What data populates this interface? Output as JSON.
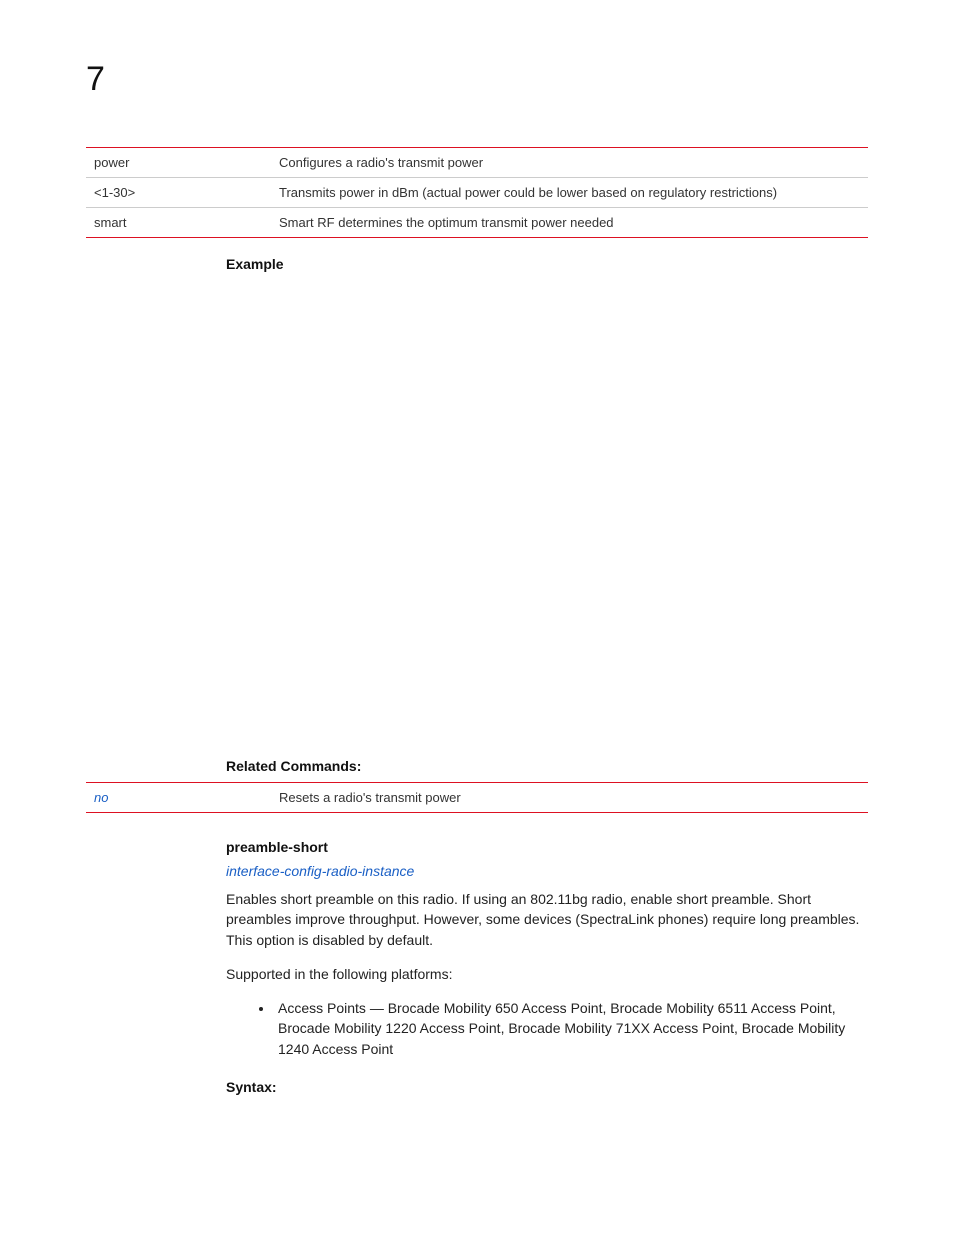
{
  "chapter_number": "7",
  "param_table": {
    "rows": [
      {
        "name": "power",
        "desc": "Configures a radio's transmit power"
      },
      {
        "name": "<1-30>",
        "desc": "Transmits power in dBm (actual power could be lower based on regulatory restrictions)"
      },
      {
        "name": "smart",
        "desc": "Smart RF determines the optimum transmit power needed"
      }
    ]
  },
  "headings": {
    "example": "Example",
    "related": "Related Commands:",
    "preamble": "preamble-short",
    "syntax": "Syntax:"
  },
  "related_table": {
    "rows": [
      {
        "cmd": "no",
        "desc": "Resets a radio's transmit power"
      }
    ]
  },
  "preamble": {
    "link": "interface-config-radio-instance",
    "desc": "Enables short preamble on this radio. If using an 802.11bg radio, enable short preamble. Short preambles improve throughput. However, some devices (SpectraLink phones) require long preambles. This option is disabled by default.",
    "platform_intro": "Supported in the following platforms:",
    "platform_bullet": "Access Points — Brocade Mobility 650 Access Point, Brocade Mobility 6511 Access Point, Brocade Mobility 1220 Access Point, Brocade Mobility 71XX Access Point, Brocade Mobility 1240 Access Point"
  }
}
